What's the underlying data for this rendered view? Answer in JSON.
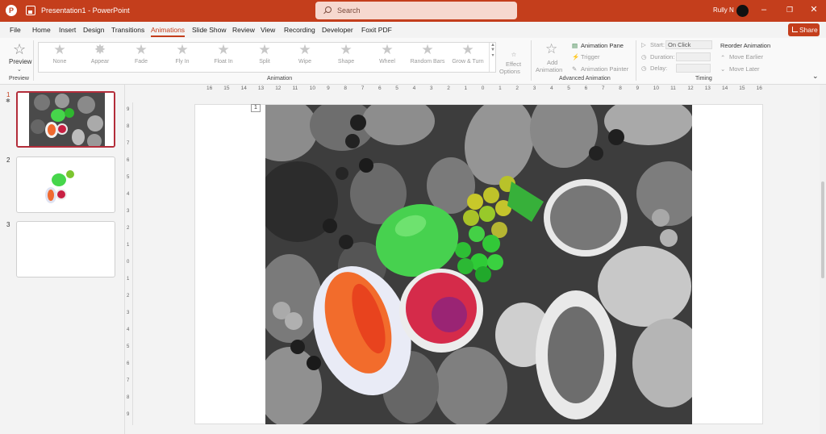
{
  "app": {
    "document_title": "Presentation1",
    "app_name": "PowerPoint",
    "title_separator": "-",
    "user": "Rully N"
  },
  "search": {
    "placeholder": "Search"
  },
  "menu": {
    "tabs": [
      "File",
      "Home",
      "Insert",
      "Design",
      "Transitions",
      "Animations",
      "Slide Show",
      "Review",
      "View",
      "Recording",
      "Developer",
      "Foxit PDF"
    ],
    "active": "Animations",
    "share_label": "Share"
  },
  "ribbon": {
    "preview": {
      "label": "Preview",
      "group": "Preview"
    },
    "animations": [
      "None",
      "Appear",
      "Fade",
      "Fly In",
      "Float In",
      "Split",
      "Wipe",
      "Shape",
      "Wheel",
      "Random Bars",
      "Grow & Turn"
    ],
    "effect_options": {
      "line1": "Effect",
      "line2": "Options"
    },
    "animation_group": "Animation",
    "add_animation": {
      "line1": "Add",
      "line2": "Animation"
    },
    "animation_pane": "Animation Pane",
    "trigger": "Trigger",
    "animation_painter": "Animation Painter",
    "advanced_group": "Advanced Animation",
    "start_label": "Start:",
    "start_value": "On Click",
    "duration_label": "Duration:",
    "delay_label": "Delay:",
    "timing_group": "Timing",
    "reorder_title": "Reorder Animation",
    "move_earlier": "Move Earlier",
    "move_later": "Move Later"
  },
  "slides": [
    {
      "number": "1",
      "active": true,
      "animation_marker": "✱"
    },
    {
      "number": "2",
      "active": false
    },
    {
      "number": "3",
      "active": false
    }
  ],
  "ruler": {
    "horizontal": [
      "16",
      "15",
      "14",
      "13",
      "12",
      "11",
      "10",
      "9",
      "8",
      "7",
      "6",
      "5",
      "4",
      "3",
      "2",
      "1",
      "0",
      "1",
      "2",
      "3",
      "4",
      "5",
      "6",
      "7",
      "8",
      "9",
      "10",
      "11",
      "12",
      "13",
      "14",
      "15",
      "16"
    ],
    "vertical": [
      "9",
      "8",
      "7",
      "6",
      "5",
      "4",
      "3",
      "2",
      "1",
      "0",
      "1",
      "2",
      "3",
      "4",
      "5",
      "6",
      "7",
      "8",
      "9"
    ]
  },
  "slide_tag": "1",
  "colors": {
    "accent": "#c43e1c",
    "active_thumb_border": "#b32d3a"
  }
}
